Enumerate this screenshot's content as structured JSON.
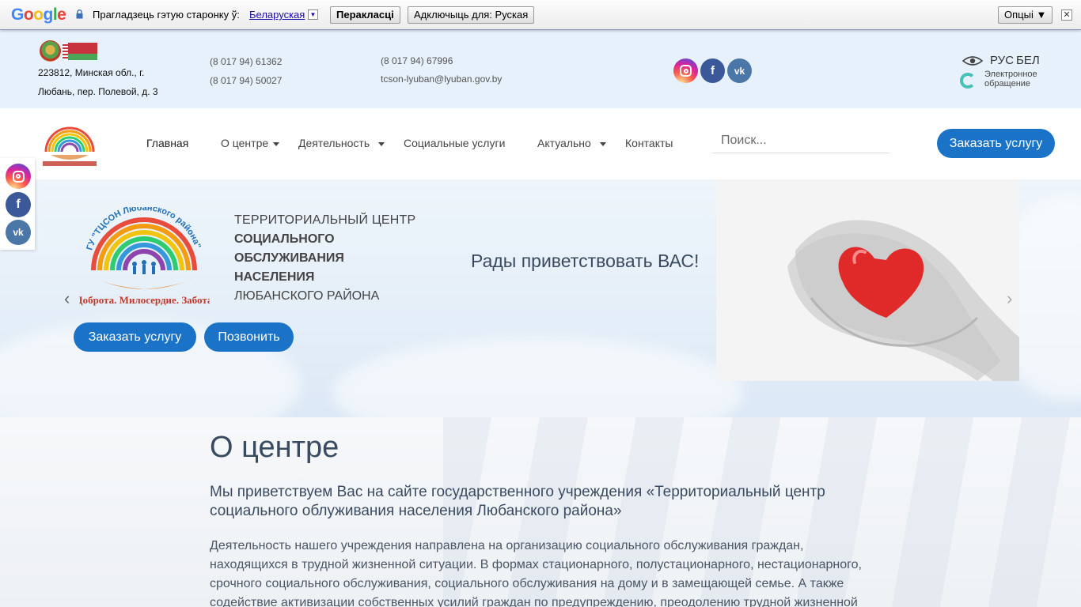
{
  "translate_bar": {
    "logo": "Google",
    "prompt": "Прагладзець гэтую старонку ў:",
    "language": "Беларуская",
    "translate_button": "Перакласці",
    "disable_button": "Адключыць для: Руская",
    "options_button": "Опцыі ▼",
    "close": "✕"
  },
  "top": {
    "address_line1": "223812, Минская обл., г.",
    "address_line2": "Любань, пер. Полевой, д. 3",
    "phone1": "(8 017 94) 61362",
    "phone2": "(8 017 94) 50027",
    "phone3": "(8 017 94) 67996",
    "email": "tcson-lyuban@lyuban.gov.by",
    "lang_rus": "РУС",
    "lang_bel": "БЕЛ",
    "appeal": "Электронное обращение",
    "vk_glyph": "vk"
  },
  "nav": {
    "items": [
      "Главная",
      "О центре",
      "Деятельность",
      "Социальные услуги",
      "Актуально",
      "Контакты"
    ],
    "search_placeholder": "Поиск...",
    "order_button": "Заказать услугу"
  },
  "hero": {
    "title_line1": "ТЕРРИТОРИАЛЬНЫЙ ЦЕНТР",
    "title_line2": "СОЦИАЛЬНОГО",
    "title_line3": "ОБСЛУЖИВАНИЯ",
    "title_line4": "НАСЕЛЕНИЯ",
    "title_line5": "ЛЮБАНСКОГО РАЙОНА",
    "greeting": "Рады приветствовать ВАС!",
    "order_button": "Заказать услугу",
    "call_button": "Позвонить",
    "prev": "‹",
    "next": "›",
    "logo_caption": "Доброта. Милосердие. Забота",
    "logo_arc": "ГУ \"ТЦСОН Любанского района\""
  },
  "about": {
    "title": "О центре",
    "subtitle": "Мы приветствуем Вас на сайте государственного учреждения «Территориальный центр социального облуживания населения Любанского района»",
    "body": "Деятельность нашего учреждения направлена на организацию социального обслуживания граждан, находящихся в трудной жизненной ситуации. В формах стационарного, полустационарного, нестационарного, срочного социального обслуживания, социального обслуживания на дому и в замещающей семье. А также содействие активизации собственных усилий граждан по предупреждению, преодолению трудной жизненной ситуации."
  },
  "colors": {
    "accent": "#1a73c6",
    "topband": "#e7f1fb",
    "heading": "#3a4a60"
  }
}
